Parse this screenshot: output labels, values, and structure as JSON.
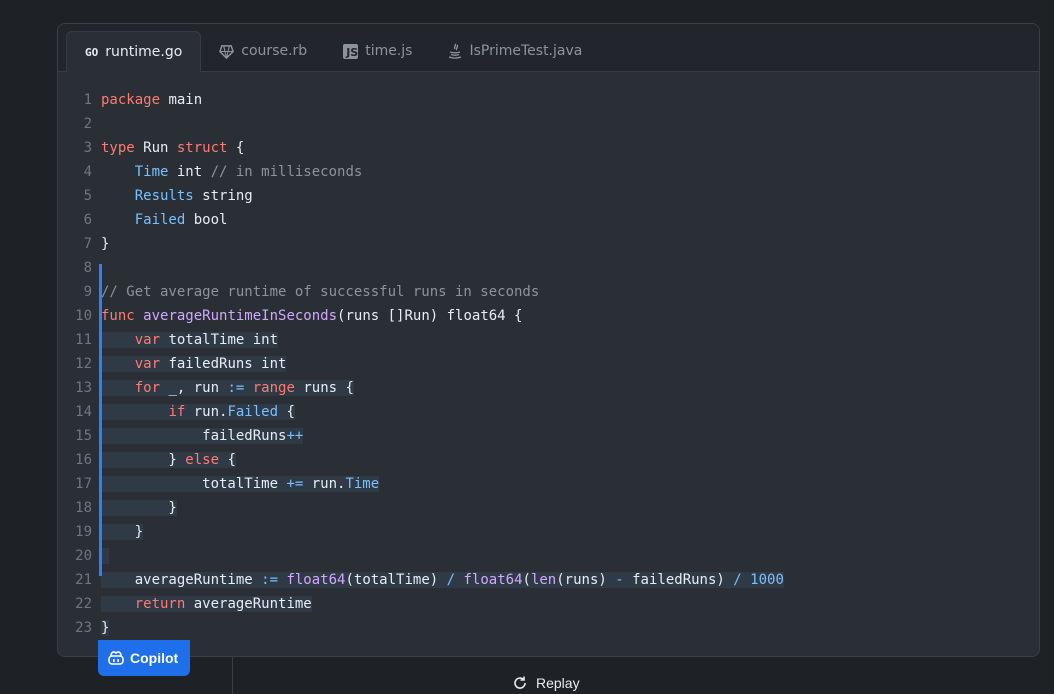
{
  "tabs": [
    {
      "label": "runtime.go",
      "icon": "go-icon",
      "active": true
    },
    {
      "label": "course.rb",
      "icon": "ruby-icon",
      "active": false
    },
    {
      "label": "time.js",
      "icon": "js-icon",
      "active": false
    },
    {
      "label": "IsPrimeTest.java",
      "icon": "java-icon",
      "active": false
    }
  ],
  "tab_icon_text": {
    "go": "GO",
    "js": "JS"
  },
  "code_lines": [
    {
      "n": "1",
      "suggested": false,
      "tokens": [
        [
          "kw",
          "package"
        ],
        [
          "id",
          " main"
        ]
      ]
    },
    {
      "n": "2",
      "suggested": false,
      "tokens": []
    },
    {
      "n": "3",
      "suggested": false,
      "tokens": [
        [
          "kw",
          "type"
        ],
        [
          "id",
          " Run "
        ],
        [
          "kw",
          "struct"
        ],
        [
          "id",
          " {"
        ]
      ]
    },
    {
      "n": "4",
      "suggested": false,
      "tokens": [
        [
          "id",
          "    "
        ],
        [
          "fd",
          "Time"
        ],
        [
          "id",
          " int "
        ],
        [
          "cm",
          "// in milliseconds"
        ]
      ]
    },
    {
      "n": "5",
      "suggested": false,
      "tokens": [
        [
          "id",
          "    "
        ],
        [
          "fd",
          "Results"
        ],
        [
          "id",
          " string"
        ]
      ]
    },
    {
      "n": "6",
      "suggested": false,
      "tokens": [
        [
          "id",
          "    "
        ],
        [
          "fd",
          "Failed"
        ],
        [
          "id",
          " bool"
        ]
      ]
    },
    {
      "n": "7",
      "suggested": false,
      "tokens": [
        [
          "id",
          "}"
        ]
      ]
    },
    {
      "n": "8",
      "suggested": false,
      "tokens": []
    },
    {
      "n": "9",
      "suggested": false,
      "tokens": [
        [
          "cm",
          "// Get average runtime of successful runs in seconds"
        ]
      ]
    },
    {
      "n": "10",
      "suggested": false,
      "tokens": [
        [
          "kw",
          "func"
        ],
        [
          "id",
          " "
        ],
        [
          "fn",
          "averageRuntimeInSeconds"
        ],
        [
          "id",
          "(runs []Run) float64 {"
        ]
      ]
    },
    {
      "n": "11",
      "suggested": true,
      "tokens": [
        [
          "id",
          "    "
        ],
        [
          "kw",
          "var"
        ],
        [
          "id",
          " totalTime int"
        ]
      ]
    },
    {
      "n": "12",
      "suggested": true,
      "tokens": [
        [
          "id",
          "    "
        ],
        [
          "kw",
          "var"
        ],
        [
          "id",
          " failedRuns int"
        ]
      ]
    },
    {
      "n": "13",
      "suggested": true,
      "tokens": [
        [
          "id",
          "    "
        ],
        [
          "kw",
          "for"
        ],
        [
          "id",
          " _, run "
        ],
        [
          "op",
          ":="
        ],
        [
          "id",
          " "
        ],
        [
          "kw",
          "range"
        ],
        [
          "id",
          " runs {"
        ]
      ]
    },
    {
      "n": "14",
      "suggested": true,
      "tokens": [
        [
          "id",
          "        "
        ],
        [
          "kw",
          "if"
        ],
        [
          "id",
          " run."
        ],
        [
          "fd",
          "Failed"
        ],
        [
          "id",
          " {"
        ]
      ]
    },
    {
      "n": "15",
      "suggested": true,
      "tokens": [
        [
          "id",
          "            failedRuns"
        ],
        [
          "op",
          "++"
        ]
      ]
    },
    {
      "n": "16",
      "suggested": true,
      "tokens": [
        [
          "id",
          "        } "
        ],
        [
          "kw",
          "else"
        ],
        [
          "id",
          " {"
        ]
      ]
    },
    {
      "n": "17",
      "suggested": true,
      "tokens": [
        [
          "id",
          "            totalTime "
        ],
        [
          "op",
          "+="
        ],
        [
          "id",
          " run."
        ],
        [
          "fd",
          "Time"
        ]
      ]
    },
    {
      "n": "18",
      "suggested": true,
      "tokens": [
        [
          "id",
          "        }"
        ]
      ]
    },
    {
      "n": "19",
      "suggested": true,
      "tokens": [
        [
          "id",
          "    }"
        ]
      ]
    },
    {
      "n": "20",
      "suggested": true,
      "tokens": [
        [
          "id",
          " "
        ]
      ]
    },
    {
      "n": "21",
      "suggested": true,
      "tokens": [
        [
          "id",
          "    averageRuntime "
        ],
        [
          "op",
          ":="
        ],
        [
          "id",
          " "
        ],
        [
          "bi",
          "float64"
        ],
        [
          "id",
          "(totalTime) "
        ],
        [
          "op",
          "/"
        ],
        [
          "id",
          " "
        ],
        [
          "bi",
          "float64"
        ],
        [
          "id",
          "("
        ],
        [
          "bi",
          "len"
        ],
        [
          "id",
          "(runs) "
        ],
        [
          "op",
          "-"
        ],
        [
          "id",
          " failedRuns) "
        ],
        [
          "op",
          "/"
        ],
        [
          "id",
          " "
        ],
        [
          "nm",
          "1000"
        ]
      ]
    },
    {
      "n": "22",
      "suggested": true,
      "tokens": [
        [
          "id",
          "    "
        ],
        [
          "kw",
          "return"
        ],
        [
          "id",
          " averageRuntime"
        ]
      ]
    },
    {
      "n": "23",
      "suggested": true,
      "tokens": [
        [
          "id",
          "}"
        ]
      ]
    }
  ],
  "copilot_label": "Copilot",
  "replay_label": "Replay",
  "colors": {
    "accent": "#1f6feb",
    "keyword": "#ff7b72",
    "function": "#d2a8ff",
    "field": "#79c0ff",
    "comment": "#8b949e"
  }
}
